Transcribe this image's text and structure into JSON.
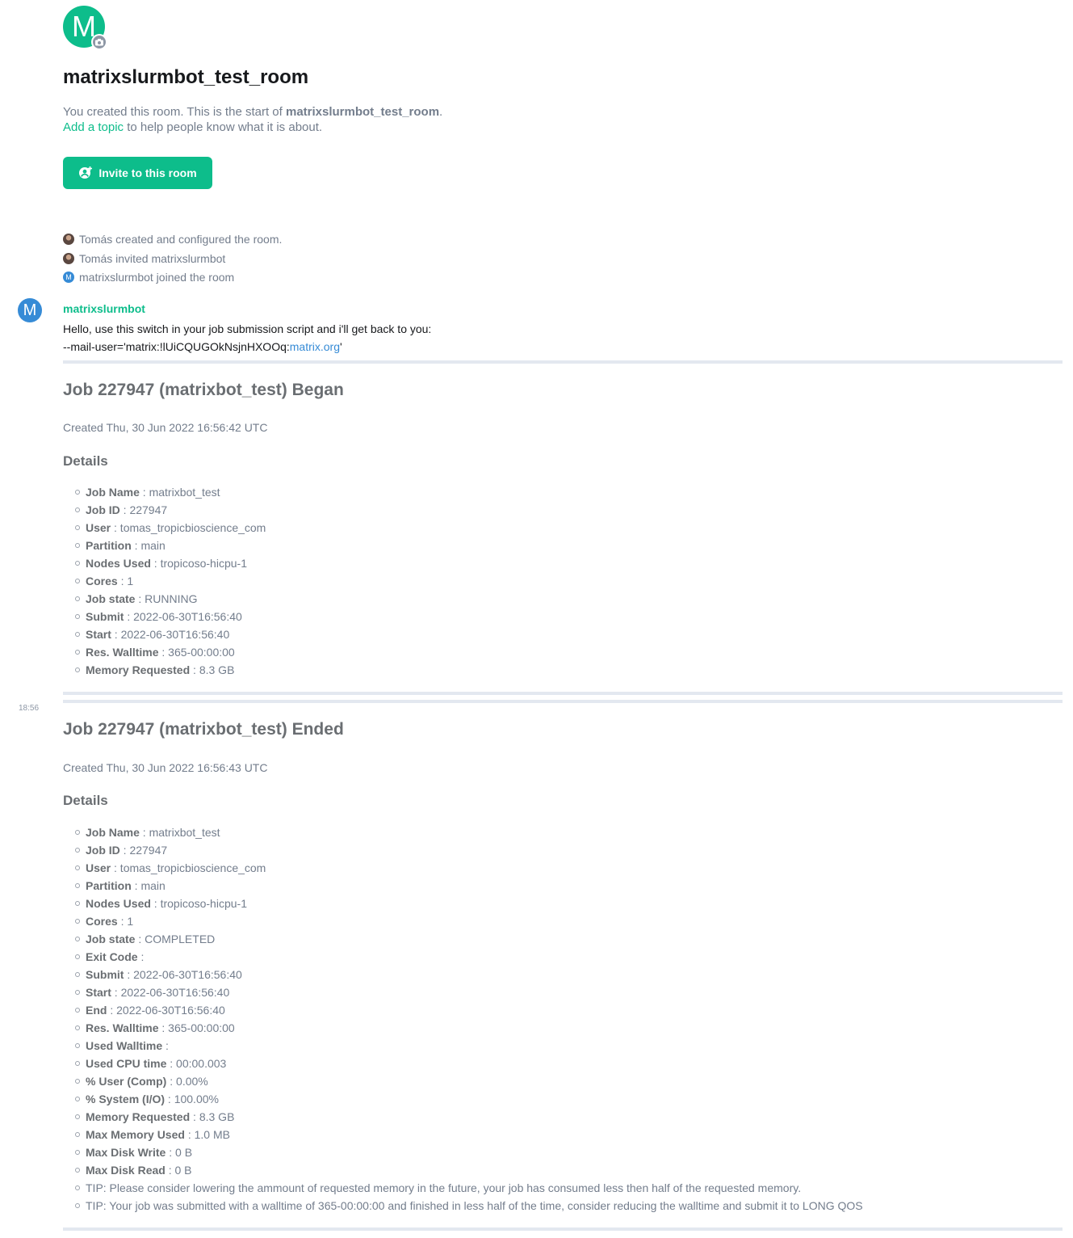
{
  "room": {
    "avatar_letter": "M",
    "avatar_color": "#0dbd8b",
    "name": "matrixslurmbot_test_room",
    "intro_prefix": "You created this room. This is the start of ",
    "intro_room": "matrixslurmbot_test_room",
    "intro_suffix": ".",
    "topic_link": "Add a topic",
    "topic_rest": " to help people know what it is about.",
    "invite_button": "Invite to this room"
  },
  "events": [
    {
      "text": "Tomás created and configured the room.",
      "avatar": "photo"
    },
    {
      "text": "Tomás invited matrixslurmbot",
      "avatar": "photo"
    },
    {
      "text": "matrixslurmbot joined the room",
      "avatar": "M"
    }
  ],
  "message": {
    "sender": "matrixslurmbot",
    "sender_avatar_letter": "M",
    "sender_color": "#368bd6",
    "line1": "Hello, use this switch in your job submission script and i'll get back to you:",
    "line2_prefix": "--mail-user='matrix:!lUiCQUGOkNsjnHXOOq:",
    "line2_link": "matrix.org",
    "line2_suffix": "'",
    "timestamp": "18:56"
  },
  "jobs": [
    {
      "title": "Job 227947 (matrixbot_test) Began",
      "created": "Created Thu, 30 Jun 2022 16:56:42 UTC",
      "details_heading": "Details",
      "details": [
        {
          "label": "Job Name",
          "value": " : matrixbot_test"
        },
        {
          "label": "Job ID",
          "value": " : 227947"
        },
        {
          "label": "User",
          "value": " : tomas_tropicbioscience_com"
        },
        {
          "label": "Partition",
          "value": " : main"
        },
        {
          "label": "Nodes Used",
          "value": " : tropicoso-hicpu-1"
        },
        {
          "label": "Cores",
          "value": " : 1"
        },
        {
          "label": "Job state",
          "value": " : RUNNING"
        },
        {
          "label": "Submit",
          "value": " : 2022-06-30T16:56:40"
        },
        {
          "label": "Start",
          "value": " : 2022-06-30T16:56:40"
        },
        {
          "label": "Res. Walltime",
          "value": " : 365-00:00:00"
        },
        {
          "label": "Memory Requested",
          "value": " : 8.3 GB"
        }
      ]
    },
    {
      "title": "Job 227947 (matrixbot_test) Ended",
      "created": "Created Thu, 30 Jun 2022 16:56:43 UTC",
      "details_heading": "Details",
      "details": [
        {
          "label": "Job Name",
          "value": " : matrixbot_test"
        },
        {
          "label": "Job ID",
          "value": " : 227947"
        },
        {
          "label": "User",
          "value": " : tomas_tropicbioscience_com"
        },
        {
          "label": "Partition",
          "value": " : main"
        },
        {
          "label": "Nodes Used",
          "value": " : tropicoso-hicpu-1"
        },
        {
          "label": "Cores",
          "value": " : 1"
        },
        {
          "label": "Job state",
          "value": " : COMPLETED"
        },
        {
          "label": "Exit Code",
          "value": " :"
        },
        {
          "label": "Submit",
          "value": " : 2022-06-30T16:56:40"
        },
        {
          "label": "Start",
          "value": " : 2022-06-30T16:56:40"
        },
        {
          "label": "End",
          "value": " : 2022-06-30T16:56:40"
        },
        {
          "label": "Res. Walltime",
          "value": " : 365-00:00:00"
        },
        {
          "label": "Used Walltime",
          "value": " :"
        },
        {
          "label": "Used CPU time",
          "value": " : 00:00.003"
        },
        {
          "label": "% User (Comp)",
          "value": " : 0.00%"
        },
        {
          "label": "% System (I/O)",
          "value": " : 100.00%"
        },
        {
          "label": "Memory Requested",
          "value": " : 8.3 GB"
        },
        {
          "label": "Max Memory Used",
          "value": " : 1.0 MB"
        },
        {
          "label": "Max Disk Write",
          "value": " : 0 B"
        },
        {
          "label": "Max Disk Read",
          "value": " : 0 B"
        },
        {
          "label": "",
          "value": "TIP: Please consider lowering the ammount of requested memory in the future, your job has consumed less then half of the requested memory."
        },
        {
          "label": "",
          "value": "TIP: Your job was submitted with a walltime of 365-00:00:00 and finished in less half of the time, consider reducing the walltime and submit it to LONG QOS"
        }
      ]
    }
  ]
}
